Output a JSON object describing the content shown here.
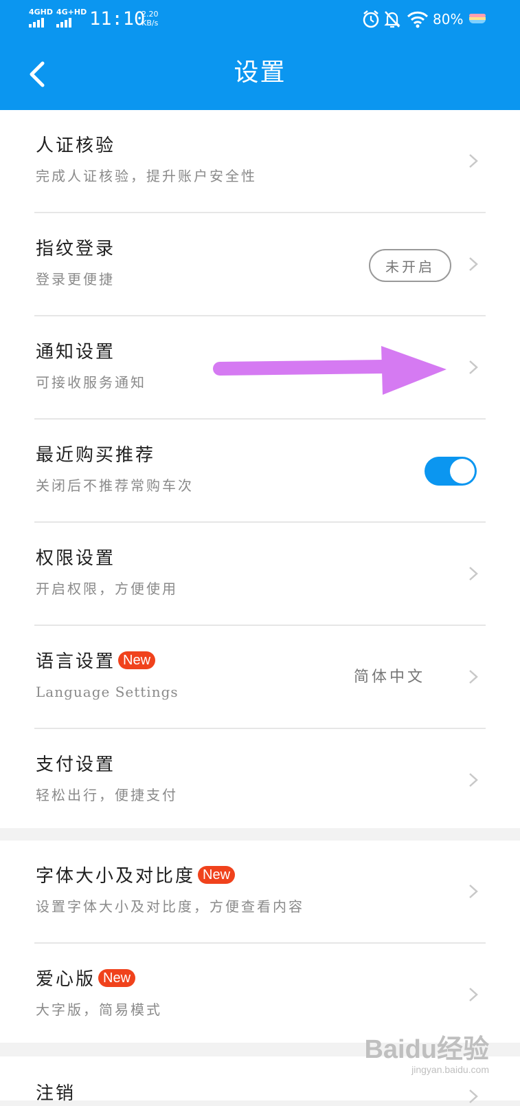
{
  "status_bar": {
    "signal_1": "4GHD",
    "signal_2": "4G+HD",
    "time": "11:10",
    "speed_value": "2.20",
    "speed_unit": "KB/s",
    "battery": "80%",
    "icons": [
      "alarm-icon",
      "mute-icon",
      "wifi-icon",
      "battery-icon"
    ]
  },
  "header": {
    "title": "设置",
    "back_icon": "chevron-left-icon"
  },
  "settings": [
    {
      "title": "人证核验",
      "subtitle": "完成人证核验，提升账户安全性"
    },
    {
      "title": "指纹登录",
      "subtitle": "登录更便捷",
      "status": "未开启"
    },
    {
      "title": "通知设置",
      "subtitle": "可接收服务通知"
    },
    {
      "title": "最近购买推荐",
      "subtitle": "关闭后不推荐常购车次",
      "toggle_on": true
    },
    {
      "title": "权限设置",
      "subtitle": "开启权限，方便使用"
    },
    {
      "title": "语言设置",
      "badge": "New",
      "subtitle": "Language Settings",
      "value": "简体中文"
    },
    {
      "title": "支付设置",
      "subtitle": "轻松出行，便捷支付"
    },
    {
      "title": "字体大小及对比度",
      "badge": "New",
      "subtitle": "设置字体大小及对比度，方便查看内容"
    },
    {
      "title": "爱心版",
      "badge": "New",
      "subtitle": "大字版，简易模式"
    },
    {
      "title": "注销"
    }
  ],
  "watermark": {
    "logo": "Baidu经验",
    "url": "jingyan.baidu.com"
  },
  "colors": {
    "brand_blue": "#0b96f0",
    "badge_red": "#f0421c",
    "arrow_purple": "#d57af2"
  }
}
